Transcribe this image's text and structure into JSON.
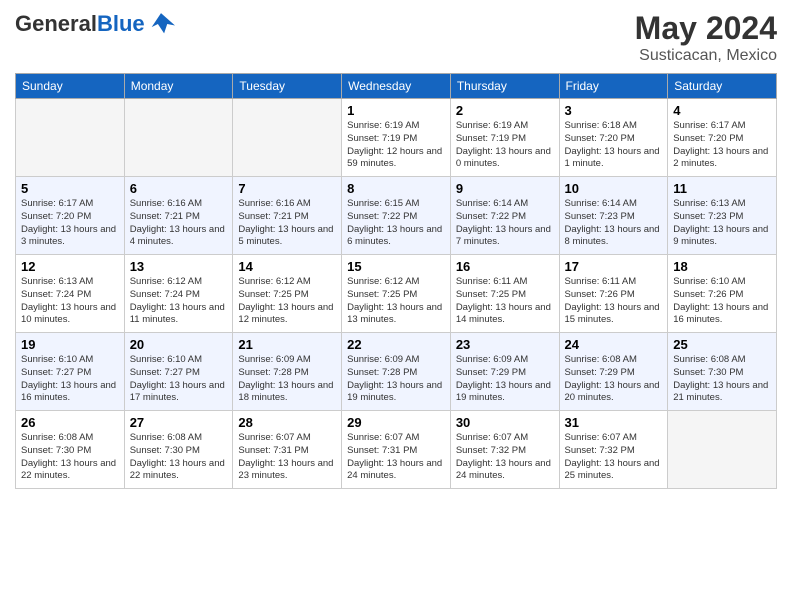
{
  "header": {
    "logo_general": "General",
    "logo_blue": "Blue",
    "title": "May 2024",
    "location": "Susticacan, Mexico"
  },
  "weekdays": [
    "Sunday",
    "Monday",
    "Tuesday",
    "Wednesday",
    "Thursday",
    "Friday",
    "Saturday"
  ],
  "weeks": [
    [
      {
        "day": "",
        "empty": true
      },
      {
        "day": "",
        "empty": true
      },
      {
        "day": "",
        "empty": true
      },
      {
        "day": "1",
        "sunrise": "6:19 AM",
        "sunset": "7:19 PM",
        "daylight": "12 hours and 59 minutes."
      },
      {
        "day": "2",
        "sunrise": "6:19 AM",
        "sunset": "7:19 PM",
        "daylight": "13 hours and 0 minutes."
      },
      {
        "day": "3",
        "sunrise": "6:18 AM",
        "sunset": "7:20 PM",
        "daylight": "13 hours and 1 minute."
      },
      {
        "day": "4",
        "sunrise": "6:17 AM",
        "sunset": "7:20 PM",
        "daylight": "13 hours and 2 minutes."
      }
    ],
    [
      {
        "day": "5",
        "sunrise": "6:17 AM",
        "sunset": "7:20 PM",
        "daylight": "13 hours and 3 minutes."
      },
      {
        "day": "6",
        "sunrise": "6:16 AM",
        "sunset": "7:21 PM",
        "daylight": "13 hours and 4 minutes."
      },
      {
        "day": "7",
        "sunrise": "6:16 AM",
        "sunset": "7:21 PM",
        "daylight": "13 hours and 5 minutes."
      },
      {
        "day": "8",
        "sunrise": "6:15 AM",
        "sunset": "7:22 PM",
        "daylight": "13 hours and 6 minutes."
      },
      {
        "day": "9",
        "sunrise": "6:14 AM",
        "sunset": "7:22 PM",
        "daylight": "13 hours and 7 minutes."
      },
      {
        "day": "10",
        "sunrise": "6:14 AM",
        "sunset": "7:23 PM",
        "daylight": "13 hours and 8 minutes."
      },
      {
        "day": "11",
        "sunrise": "6:13 AM",
        "sunset": "7:23 PM",
        "daylight": "13 hours and 9 minutes."
      }
    ],
    [
      {
        "day": "12",
        "sunrise": "6:13 AM",
        "sunset": "7:24 PM",
        "daylight": "13 hours and 10 minutes."
      },
      {
        "day": "13",
        "sunrise": "6:12 AM",
        "sunset": "7:24 PM",
        "daylight": "13 hours and 11 minutes."
      },
      {
        "day": "14",
        "sunrise": "6:12 AM",
        "sunset": "7:25 PM",
        "daylight": "13 hours and 12 minutes."
      },
      {
        "day": "15",
        "sunrise": "6:12 AM",
        "sunset": "7:25 PM",
        "daylight": "13 hours and 13 minutes."
      },
      {
        "day": "16",
        "sunrise": "6:11 AM",
        "sunset": "7:25 PM",
        "daylight": "13 hours and 14 minutes."
      },
      {
        "day": "17",
        "sunrise": "6:11 AM",
        "sunset": "7:26 PM",
        "daylight": "13 hours and 15 minutes."
      },
      {
        "day": "18",
        "sunrise": "6:10 AM",
        "sunset": "7:26 PM",
        "daylight": "13 hours and 16 minutes."
      }
    ],
    [
      {
        "day": "19",
        "sunrise": "6:10 AM",
        "sunset": "7:27 PM",
        "daylight": "13 hours and 16 minutes."
      },
      {
        "day": "20",
        "sunrise": "6:10 AM",
        "sunset": "7:27 PM",
        "daylight": "13 hours and 17 minutes."
      },
      {
        "day": "21",
        "sunrise": "6:09 AM",
        "sunset": "7:28 PM",
        "daylight": "13 hours and 18 minutes."
      },
      {
        "day": "22",
        "sunrise": "6:09 AM",
        "sunset": "7:28 PM",
        "daylight": "13 hours and 19 minutes."
      },
      {
        "day": "23",
        "sunrise": "6:09 AM",
        "sunset": "7:29 PM",
        "daylight": "13 hours and 19 minutes."
      },
      {
        "day": "24",
        "sunrise": "6:08 AM",
        "sunset": "7:29 PM",
        "daylight": "13 hours and 20 minutes."
      },
      {
        "day": "25",
        "sunrise": "6:08 AM",
        "sunset": "7:30 PM",
        "daylight": "13 hours and 21 minutes."
      }
    ],
    [
      {
        "day": "26",
        "sunrise": "6:08 AM",
        "sunset": "7:30 PM",
        "daylight": "13 hours and 22 minutes."
      },
      {
        "day": "27",
        "sunrise": "6:08 AM",
        "sunset": "7:30 PM",
        "daylight": "13 hours and 22 minutes."
      },
      {
        "day": "28",
        "sunrise": "6:07 AM",
        "sunset": "7:31 PM",
        "daylight": "13 hours and 23 minutes."
      },
      {
        "day": "29",
        "sunrise": "6:07 AM",
        "sunset": "7:31 PM",
        "daylight": "13 hours and 24 minutes."
      },
      {
        "day": "30",
        "sunrise": "6:07 AM",
        "sunset": "7:32 PM",
        "daylight": "13 hours and 24 minutes."
      },
      {
        "day": "31",
        "sunrise": "6:07 AM",
        "sunset": "7:32 PM",
        "daylight": "13 hours and 25 minutes."
      },
      {
        "day": "",
        "empty": true
      }
    ]
  ]
}
